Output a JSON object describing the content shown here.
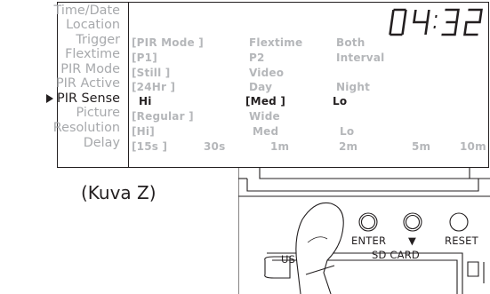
{
  "display": {
    "clock": "04:32",
    "menu": [
      {
        "label": "Time/Date",
        "active": false
      },
      {
        "label": "Location",
        "active": false
      },
      {
        "label": "Trigger",
        "active": false
      },
      {
        "label": "Flextime",
        "active": false
      },
      {
        "label": "PIR Mode",
        "active": false
      },
      {
        "label": "PIR Active",
        "active": false
      },
      {
        "label": "PIR Sense",
        "active": true
      },
      {
        "label": "Picture",
        "active": false
      },
      {
        "label": "Resolution",
        "active": false
      },
      {
        "label": "Delay",
        "active": false
      }
    ],
    "rows": {
      "trigger": [
        "[PIR Mode ]",
        "Flextime",
        "Both"
      ],
      "flextime": [
        "[P1]",
        "P2",
        "Interval"
      ],
      "pir_mode": [
        "[Still ]",
        "Video"
      ],
      "pir_active": [
        "[24Hr ]",
        "Day",
        "Night"
      ],
      "pir_sense": [
        "Hi",
        "[Med ]",
        "Lo"
      ],
      "picture": [
        "[Regular ]",
        "Wide"
      ],
      "resolution": [
        "[Hi]",
        "Med",
        "Lo"
      ],
      "delay": [
        "[15s ]",
        "30s",
        "1m",
        "2m",
        "5m",
        "10m"
      ]
    },
    "battery_icon": "battery-icon",
    "colors": {
      "active": "#231f20",
      "inactive": "#a7a9ac"
    }
  },
  "caption": "(Kuva Z)",
  "device": {
    "enter_label": "ENTER",
    "down_label": "▼",
    "reset_label": "RESET",
    "sd_card_label": "SD CARD",
    "usb_label": "US"
  }
}
